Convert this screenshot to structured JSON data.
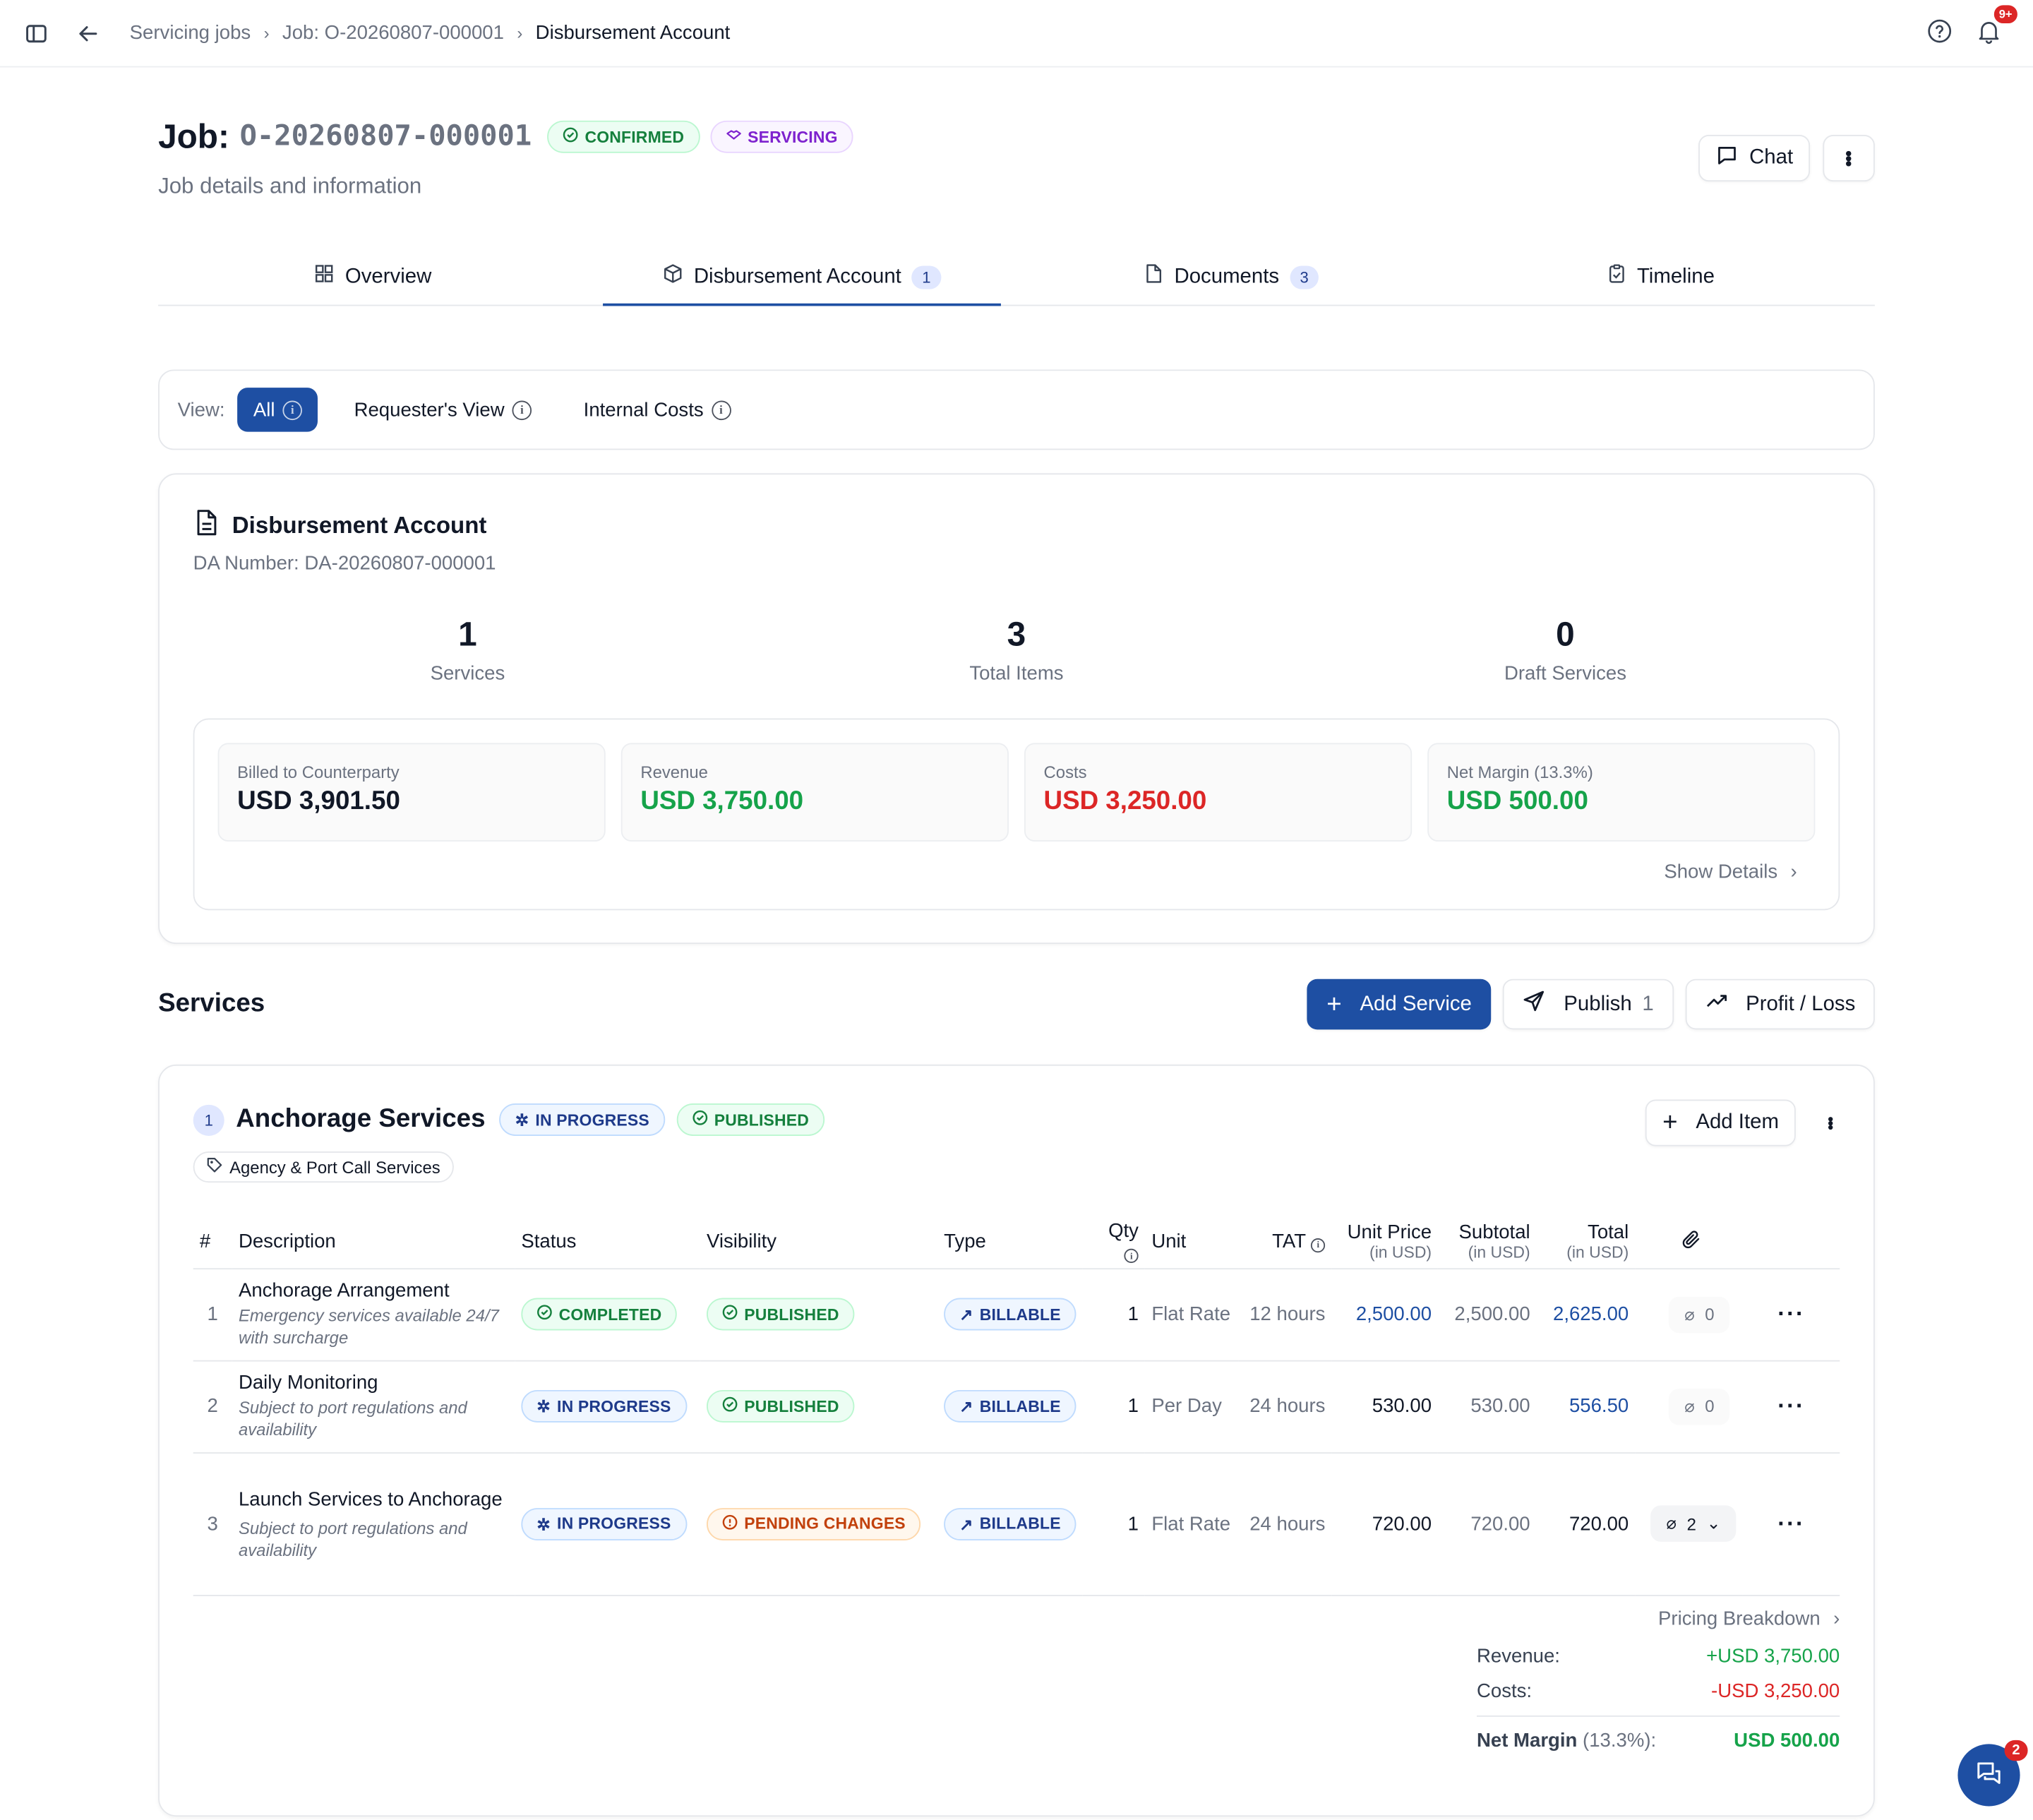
{
  "breadcrumb": [
    "Servicing jobs",
    "Job: O-20260807-000001",
    "Disbursement Account"
  ],
  "notifications_badge": "9+",
  "job": {
    "prefix": "Job:",
    "number": "O-20260807-000001",
    "status_badge": "CONFIRMED",
    "type_badge": "SERVICING",
    "subtitle": "Job details and information",
    "chat_label": "Chat"
  },
  "tabs": [
    {
      "label": "Overview",
      "icon": "grid-icon",
      "count": ""
    },
    {
      "label": "Disbursement Account",
      "icon": "package-icon",
      "count": "1"
    },
    {
      "label": "Documents",
      "icon": "file-icon",
      "count": "3"
    },
    {
      "label": "Timeline",
      "icon": "clipboard-icon",
      "count": ""
    }
  ],
  "view": {
    "label": "View:",
    "options": [
      "All",
      "Requester's View",
      "Internal Costs"
    ],
    "selected": "All"
  },
  "disbursement": {
    "title": "Disbursement Account",
    "da_number": "DA Number: DA-20260807-000001",
    "stats": [
      {
        "value": "1",
        "label": "Services"
      },
      {
        "value": "3",
        "label": "Total Items"
      },
      {
        "value": "0",
        "label": "Draft Services"
      }
    ],
    "financials": [
      {
        "label": "Billed to Counterparty",
        "value": "USD 3,901.50",
        "color": "#111827"
      },
      {
        "label": "Revenue",
        "value": "USD 3,750.00",
        "color": "#16a34a"
      },
      {
        "label": "Costs",
        "value": "USD 3,250.00",
        "color": "#dc2626"
      },
      {
        "label": "Net Margin (13.3%)",
        "value": "USD 500.00",
        "color": "#16a34a"
      }
    ],
    "show_details": "Show Details"
  },
  "services": {
    "title": "Services",
    "add_service": "Add Service",
    "publish": "Publish",
    "publish_count": "1",
    "profit_loss": "Profit / Loss"
  },
  "service": {
    "index": "1",
    "name": "Anchorage Services",
    "status": "IN PROGRESS",
    "visibility": "PUBLISHED",
    "tag": "Agency & Port Call Services",
    "add_item": "Add Item",
    "columns": {
      "num": "#",
      "description": "Description",
      "status": "Status",
      "visibility": "Visibility",
      "type": "Type",
      "qty": "Qty",
      "unit": "Unit",
      "tat": "TAT",
      "unit_price": "Unit Price",
      "subtotal": "Subtotal",
      "total": "Total",
      "in_usd": "(in USD)"
    },
    "items": [
      {
        "n": "1",
        "title": "Anchorage Arrangement",
        "note": "Emergency services available 24/7 with surcharge",
        "status": "COMPLETED",
        "visibility": "PUBLISHED",
        "type": "BILLABLE",
        "qty": "1",
        "unit": "Flat Rate",
        "tat": "12 hours",
        "unit_price": "2,500.00",
        "subtotal": "2,500.00",
        "total": "2,625.00",
        "attachments": "0"
      },
      {
        "n": "2",
        "title": "Daily Monitoring",
        "note": "Subject to port regulations and availability",
        "status": "IN PROGRESS",
        "visibility": "PUBLISHED",
        "type": "BILLABLE",
        "qty": "1",
        "unit": "Per Day",
        "tat": "24 hours",
        "unit_price": "530.00",
        "subtotal": "530.00",
        "total": "556.50",
        "attachments": "0"
      },
      {
        "n": "3",
        "title": "Launch Services to Anchorage",
        "note": "Subject to port regulations and availability",
        "status": "IN PROGRESS",
        "visibility": "PENDING CHANGES",
        "type": "BILLABLE",
        "qty": "1",
        "unit": "Flat Rate",
        "tat": "24 hours",
        "unit_price": "720.00",
        "subtotal": "720.00",
        "total": "720.00",
        "attachments": "2"
      }
    ],
    "pricing": {
      "label": "Pricing Breakdown",
      "revenue_label": "Revenue:",
      "revenue": "+USD 3,750.00",
      "costs_label": "Costs:",
      "costs": "-USD 3,250.00",
      "margin_label": "Net Margin",
      "margin_pct": "(13.3%):",
      "margin": "USD 500.00"
    }
  },
  "chat_fab_badge": "2"
}
